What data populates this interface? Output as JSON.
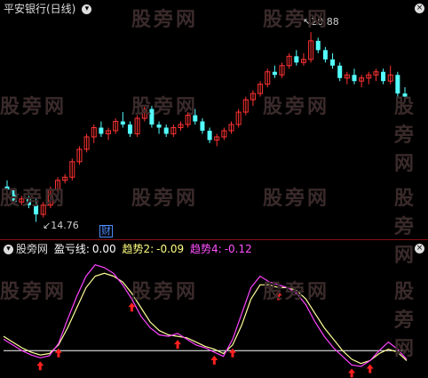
{
  "header": {
    "stock_name": "平安银行(日线)",
    "dropdown_icon": "chevron-down-icon",
    "close_icon": "close-icon"
  },
  "price_panel": {
    "high_label": "20.88",
    "low_label": "14.76",
    "event_marker": "财",
    "colors": {
      "up": "#ff3232",
      "down": "#54ffff",
      "event": "#4d8cff"
    }
  },
  "indicator_panel": {
    "source_label": "股旁网",
    "title": "盈亏线",
    "values": [
      {
        "label": "盈亏线:",
        "value": "0.00",
        "color": "#ffffff"
      },
      {
        "label": "趋势2:",
        "value": "-0.09",
        "color": "#ffff80"
      },
      {
        "label": "趋势4:",
        "value": "-0.12",
        "color": "#ff50ff"
      }
    ],
    "series_colors": {
      "trend2": "#ffff99",
      "trend4": "#ff44ff",
      "zero": "#ffffff",
      "arrow": "#ff2020"
    }
  },
  "watermark": "股旁网",
  "chart_data": [
    {
      "type": "candlestick",
      "candles": [
        [
          15.9,
          16.1,
          15.7,
          15.8
        ],
        [
          15.8,
          15.85,
          15.3,
          15.4
        ],
        [
          15.4,
          15.6,
          15.3,
          15.5
        ],
        [
          15.5,
          15.6,
          15.2,
          15.3
        ],
        [
          15.3,
          15.5,
          14.76,
          15.0
        ],
        [
          15.0,
          15.4,
          14.9,
          15.3
        ],
        [
          15.3,
          15.9,
          15.2,
          15.8
        ],
        [
          15.8,
          16.2,
          15.7,
          16.1
        ],
        [
          16.1,
          16.3,
          16.0,
          16.2
        ],
        [
          16.2,
          16.8,
          16.1,
          16.7
        ],
        [
          16.7,
          17.2,
          16.6,
          17.1
        ],
        [
          17.1,
          17.6,
          17.0,
          17.5
        ],
        [
          17.5,
          17.9,
          17.3,
          17.8
        ],
        [
          17.8,
          18.0,
          17.5,
          17.6
        ],
        [
          17.6,
          17.8,
          17.4,
          17.7
        ],
        [
          17.7,
          18.1,
          17.6,
          18.0
        ],
        [
          18.0,
          18.3,
          17.8,
          17.9
        ],
        [
          17.9,
          18.0,
          17.5,
          17.6
        ],
        [
          17.6,
          18.2,
          17.5,
          18.1
        ],
        [
          18.1,
          18.5,
          18.0,
          18.4
        ],
        [
          18.4,
          18.5,
          17.8,
          17.9
        ],
        [
          17.9,
          18.0,
          17.6,
          17.8
        ],
        [
          17.8,
          17.9,
          17.5,
          17.6
        ],
        [
          17.6,
          17.9,
          17.5,
          17.8
        ],
        [
          17.8,
          18.0,
          17.7,
          17.9
        ],
        [
          17.9,
          18.3,
          17.8,
          18.2
        ],
        [
          18.2,
          18.4,
          17.9,
          18.0
        ],
        [
          18.0,
          18.1,
          17.6,
          17.7
        ],
        [
          17.7,
          17.8,
          17.3,
          17.4
        ],
        [
          17.4,
          17.6,
          17.2,
          17.5
        ],
        [
          17.5,
          17.8,
          17.4,
          17.7
        ],
        [
          17.7,
          18.0,
          17.6,
          17.9
        ],
        [
          17.9,
          18.4,
          17.8,
          18.3
        ],
        [
          18.3,
          18.8,
          18.2,
          18.7
        ],
        [
          18.7,
          19.0,
          18.5,
          18.9
        ],
        [
          18.9,
          19.3,
          18.8,
          19.2
        ],
        [
          19.2,
          19.7,
          19.1,
          19.6
        ],
        [
          19.6,
          19.8,
          19.4,
          19.5
        ],
        [
          19.5,
          19.9,
          19.4,
          19.8
        ],
        [
          19.8,
          20.2,
          19.7,
          20.1
        ],
        [
          20.1,
          20.3,
          19.8,
          19.9
        ],
        [
          19.9,
          20.2,
          19.8,
          20.0
        ],
        [
          20.0,
          20.88,
          19.9,
          20.6
        ],
        [
          20.6,
          20.7,
          20.2,
          20.3
        ],
        [
          20.3,
          20.4,
          19.9,
          20.0
        ],
        [
          20.0,
          20.2,
          19.7,
          19.8
        ],
        [
          19.8,
          19.9,
          19.3,
          19.4
        ],
        [
          19.4,
          19.6,
          19.2,
          19.5
        ],
        [
          19.5,
          19.7,
          19.2,
          19.3
        ],
        [
          19.3,
          19.5,
          19.1,
          19.4
        ],
        [
          19.4,
          19.6,
          19.2,
          19.5
        ],
        [
          19.5,
          19.7,
          19.3,
          19.6
        ],
        [
          19.6,
          19.7,
          19.2,
          19.3
        ],
        [
          19.3,
          19.8,
          19.2,
          19.5
        ],
        [
          19.5,
          19.6,
          18.8,
          18.9
        ],
        [
          18.9,
          19.1,
          18.7,
          18.8
        ]
      ],
      "high_annotation": 20.88,
      "low_annotation": 14.76,
      "ylim": [
        14.4,
        21.4
      ]
    },
    {
      "type": "line",
      "series": [
        {
          "name": "趋势2",
          "values": [
            0.5,
            0.3,
            0.1,
            -0.05,
            -0.15,
            -0.1,
            0.2,
            0.8,
            1.5,
            2.2,
            2.6,
            2.7,
            2.6,
            2.4,
            2.0,
            1.5,
            1.0,
            0.7,
            0.55,
            0.5,
            0.45,
            0.3,
            0.15,
            0.05,
            -0.1,
            0.2,
            0.9,
            1.8,
            2.3,
            2.3,
            2.2,
            2.2,
            2.1,
            1.8,
            1.3,
            0.8,
            0.4,
            0.0,
            -0.3,
            -0.45,
            -0.35,
            -0.1,
            0.05,
            -0.05,
            -0.35
          ]
        },
        {
          "name": "趋势4",
          "values": [
            0.4,
            0.2,
            0.0,
            -0.15,
            -0.25,
            -0.18,
            0.25,
            1.1,
            1.9,
            2.6,
            3.0,
            2.9,
            2.7,
            2.3,
            1.8,
            1.2,
            0.8,
            0.55,
            0.5,
            0.6,
            0.4,
            0.2,
            0.1,
            -0.05,
            -0.2,
            0.4,
            1.3,
            2.2,
            2.6,
            2.4,
            2.3,
            2.2,
            2.0,
            1.6,
            1.0,
            0.5,
            0.1,
            -0.2,
            -0.5,
            -0.55,
            -0.35,
            0.0,
            0.3,
            0.05,
            -0.3
          ]
        }
      ],
      "zero_line": 0.0,
      "buy_arrows_at": [
        4,
        6,
        14,
        19,
        23,
        25,
        30,
        38,
        40
      ],
      "ylim": [
        -0.8,
        3.3
      ]
    }
  ]
}
